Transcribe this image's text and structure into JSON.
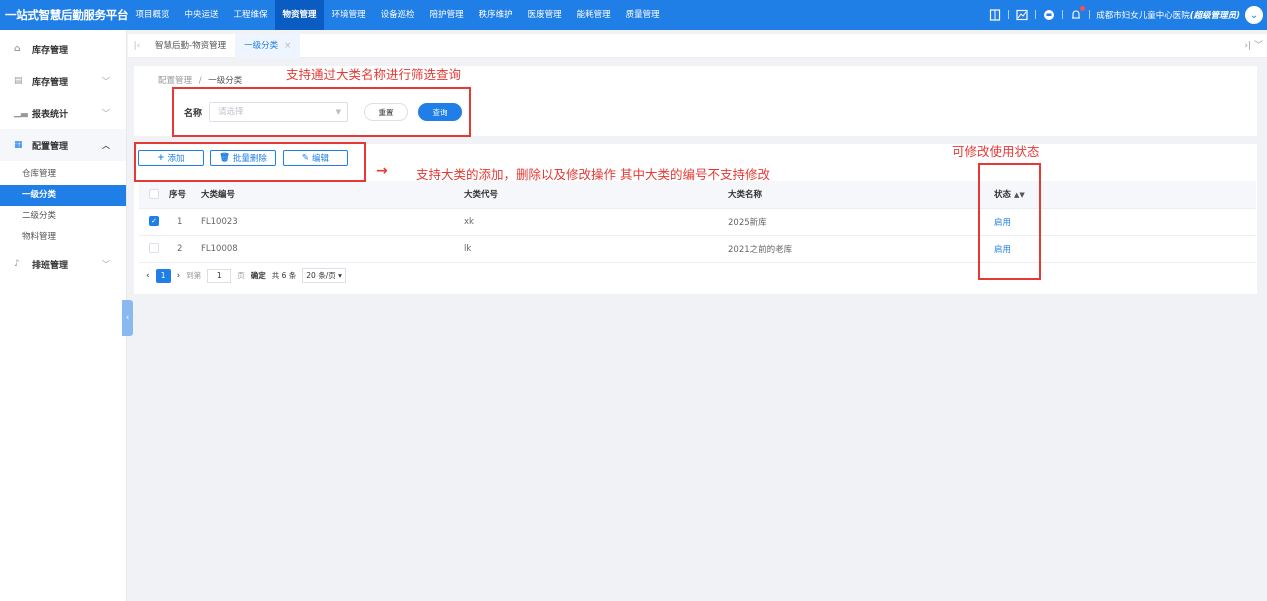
{
  "app": {
    "brand": "一站式智慧后勤服务平台",
    "nav": [
      "项目概览",
      "中央运送",
      "工程维保",
      "物资管理",
      "环境管理",
      "设备巡检",
      "陪护管理",
      "秩序维护",
      "医废管理",
      "能耗管理",
      "质量管理"
    ],
    "active_nav": "物资管理",
    "user": "成都市妇女儿童中心医院",
    "role": "(超级管理员)"
  },
  "sidebar": {
    "groups": [
      {
        "label": "库存管理",
        "icon": "home-icon"
      },
      {
        "label": "库存管理",
        "icon": "archive-icon"
      },
      {
        "label": "报表统计",
        "icon": "chart-icon"
      },
      {
        "label": "配置管理",
        "icon": "grid-icon"
      }
    ],
    "sub_items": [
      "仓库管理",
      "一级分类",
      "二级分类",
      "物料管理"
    ],
    "after": {
      "label": "排班管理",
      "icon": "bell-icon"
    }
  },
  "tabs": {
    "items": [
      "智慧后勤-物资管理",
      "一级分类"
    ],
    "close": "×"
  },
  "breadcrumb": {
    "parent": "配置管理",
    "sep": "/",
    "current": "一级分类"
  },
  "filter": {
    "label": "名称",
    "placeholder": "请选择",
    "reset": "重置",
    "query": "查询"
  },
  "toolbar": {
    "add": "添加",
    "batch_delete": "批量删除",
    "edit": "编辑"
  },
  "table": {
    "headers": [
      "序号",
      "大类编号",
      "大类代号",
      "大类名称",
      "状态"
    ],
    "rows": [
      {
        "idx": "1",
        "code": "FL10023",
        "alias": "xk",
        "name": "2025新库",
        "status": "启用",
        "checked": true
      },
      {
        "idx": "2",
        "code": "FL10008",
        "alias": "lk",
        "name": "2021之前的老库",
        "status": "启用",
        "checked": false
      }
    ]
  },
  "pager": {
    "current": "1",
    "goto": "到第",
    "page_input": "1",
    "page_unit": "页",
    "confirm": "确定",
    "total": "共 6 条",
    "size": "20 条/页"
  },
  "annotations": {
    "filter_note": "支持通过大类名称进行筛选查询",
    "toolbar_note": "支持大类的添加，删除以及修改操作 其中大类的编号不支持修改",
    "status_note": "可修改使用状态",
    "arrow": "→"
  },
  "colors": {
    "primary": "#1f7fe6",
    "annotation": "#e53935"
  }
}
